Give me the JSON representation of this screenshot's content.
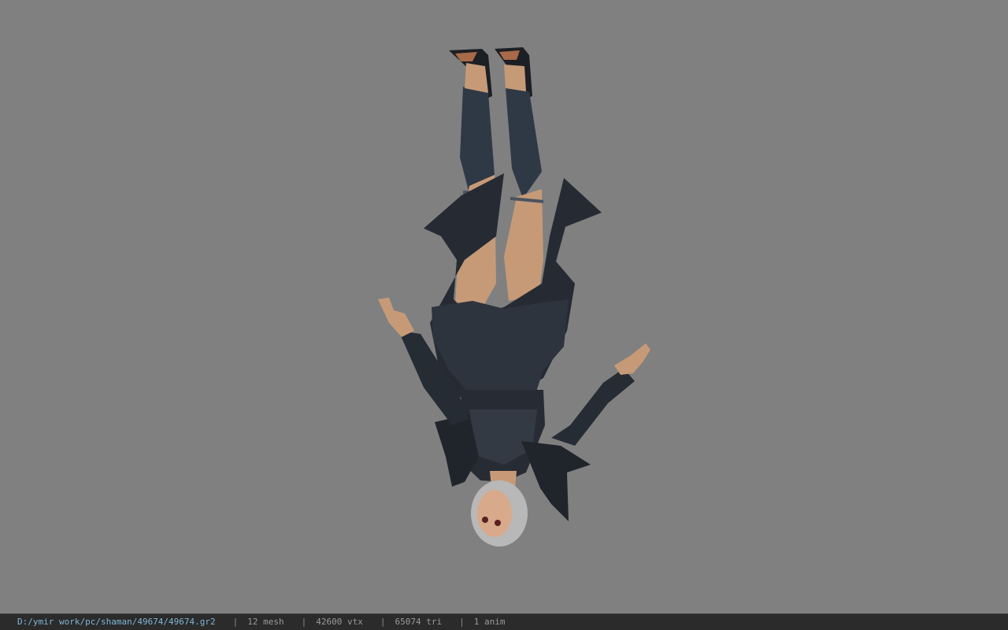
{
  "viewer": {
    "background_color": "#808080",
    "model_description": "3D character model rendered upside down"
  },
  "statusbar": {
    "file_path": "D:/ymir work/pc/shaman/49674/49674.gr2",
    "separator": "|",
    "mesh_count": "12 mesh",
    "vertex_count": "42600 vtx",
    "triangle_count": "65074 tri",
    "anim_count": "1 anim",
    "text_color": "#9a9a9a",
    "path_color": "#7fb6d6"
  }
}
